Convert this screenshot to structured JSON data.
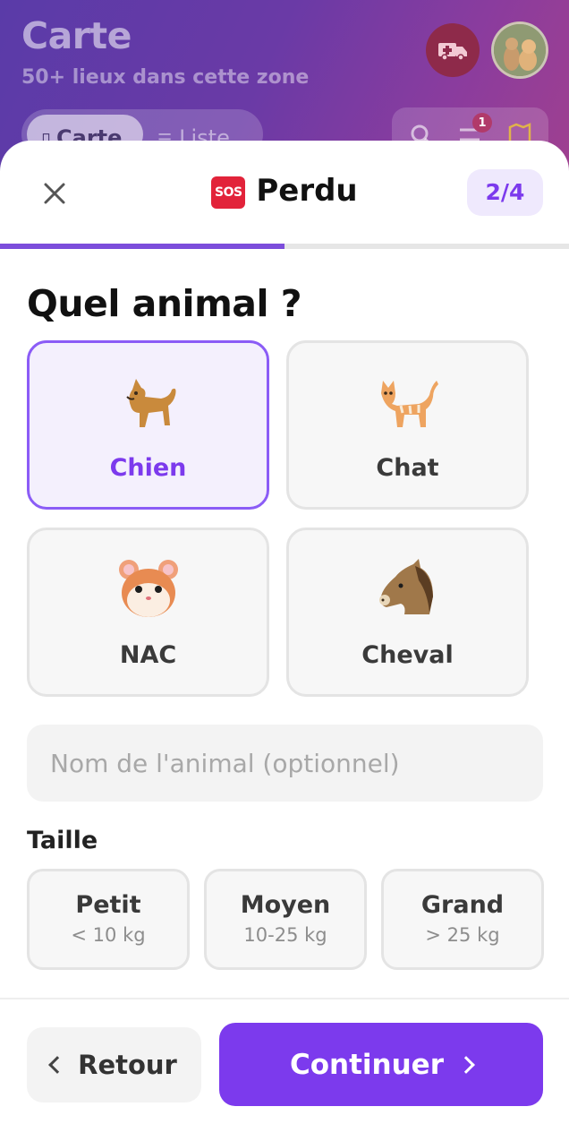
{
  "map_header": {
    "title": "Carte",
    "subtitle": "50+ lieux dans cette zone",
    "view_toggle": {
      "map_label": "Carte",
      "list_label": "Liste"
    },
    "filter_count": "1"
  },
  "sheet": {
    "title": "Perdu",
    "sos_badge": "SOS",
    "step": "2/4",
    "progress": 0.5,
    "question": "Quel animal ?",
    "animals": [
      {
        "label": "Chien",
        "icon": "dog-icon",
        "selected": true
      },
      {
        "label": "Chat",
        "icon": "cat-icon",
        "selected": false
      },
      {
        "label": "NAC",
        "icon": "hamster-icon",
        "selected": false
      },
      {
        "label": "Cheval",
        "icon": "horse-icon",
        "selected": false
      }
    ],
    "name_input": {
      "placeholder": "Nom de l'animal (optionnel)",
      "value": ""
    },
    "size_label": "Taille",
    "sizes": [
      {
        "name": "Petit",
        "range": "< 10 kg"
      },
      {
        "name": "Moyen",
        "range": "10-25 kg"
      },
      {
        "name": "Grand",
        "range": "> 25 kg"
      }
    ],
    "back_label": "Retour",
    "continue_label": "Continuer"
  },
  "colors": {
    "accent": "#7c3aed",
    "selected_border": "#8b5cf6",
    "sos_red": "#e2233a"
  }
}
